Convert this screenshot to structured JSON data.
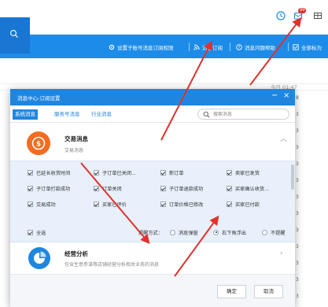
{
  "header": {
    "badge_count": "99",
    "icons": [
      "clock-icon",
      "bell-icon",
      "grid-icon"
    ]
  },
  "toolbar": {
    "items": [
      {
        "icon": "gear-icon",
        "label": "设置子账号消息订阅权限"
      },
      {
        "icon": "rss-icon",
        "label": "消息订阅"
      },
      {
        "icon": "help-icon",
        "label": "消息问题帮助"
      },
      {
        "icon": "checkbox-icon",
        "label": "全部标为"
      }
    ]
  },
  "background": {
    "time": "今日 01:47",
    "digits": [
      "8",
      "3",
      "3",
      "3",
      "3",
      "3",
      "3",
      "3",
      "3",
      "3",
      "3",
      "3",
      "3"
    ]
  },
  "dialog": {
    "title": "消息中心-订阅设置",
    "minimize": "−",
    "close": "×",
    "tabs": [
      {
        "label": "系统消息",
        "active": true
      },
      {
        "label": "服务号消息",
        "active": false
      },
      {
        "label": "行业消息",
        "active": false
      }
    ],
    "search_placeholder": "搜索消息",
    "sections": [
      {
        "title": "交易消息",
        "subtitle": "交易消息",
        "color": "#f36c21",
        "expanded": true
      },
      {
        "title": "经营分析",
        "subtitle": "包含生意参谋等店铺经营分析相关业务的消息",
        "color": "#1f86e0",
        "expanded": false
      }
    ],
    "options": [
      [
        "已延长收货时间",
        "子订单已关闭...",
        "新订单",
        "卖家已发货"
      ],
      [
        "子订单打款成功",
        "订单关闭",
        "子订单退款成功",
        "买家确认收货..."
      ],
      [
        "交易成功",
        "买家已评价",
        "订单价格已修改",
        "买家已付款"
      ]
    ],
    "select_all": "全选",
    "reminder_label": "提醒方式：",
    "reminder_options": [
      {
        "label": "消息弹窗",
        "selected": false
      },
      {
        "label": "右下角浮出",
        "selected": true
      },
      {
        "label": "不提醒",
        "selected": false
      }
    ],
    "confirm": "确定",
    "cancel": "取消"
  },
  "colors": {
    "primary": "#1f86e0",
    "toolbar": "#1d8ce8",
    "arrow": "#e0322b",
    "trade_icon": "#f36c21",
    "analysis_icon": "#1f86e0"
  }
}
